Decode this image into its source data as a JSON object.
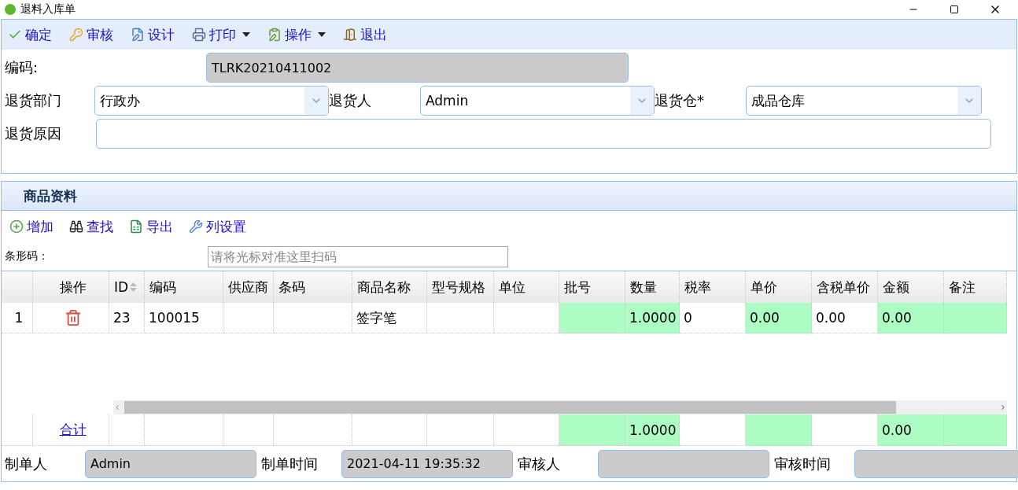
{
  "window": {
    "title": "退料入库单"
  },
  "toolbar": [
    {
      "label": "确定",
      "kind": "check",
      "menu": false
    },
    {
      "label": "审核",
      "kind": "key",
      "menu": false
    },
    {
      "label": "设计",
      "kind": "design",
      "menu": false
    },
    {
      "label": "打印",
      "kind": "print",
      "menu": true
    },
    {
      "label": "操作",
      "kind": "operate",
      "menu": true
    },
    {
      "label": "退出",
      "kind": "exit",
      "menu": false
    }
  ],
  "form": {
    "code": {
      "label": "编码:",
      "value": "TLRK20210411002"
    },
    "selects": [
      {
        "label": "退货部门",
        "value": "行政办"
      },
      {
        "label": "退货人",
        "value": "Admin"
      },
      {
        "label": "退货仓*",
        "value": "成品仓库"
      }
    ],
    "reason": {
      "label": "退货原因"
    }
  },
  "section": {
    "title": "商品资料"
  },
  "grid_toolbar": [
    {
      "label": "增加",
      "kind": "add"
    },
    {
      "label": "查找",
      "kind": "find"
    },
    {
      "label": "导出",
      "kind": "export"
    },
    {
      "label": "列设置",
      "kind": "columns"
    }
  ],
  "barcode": {
    "label": "条形码：",
    "placeholder": "请将光标对准这里扫码"
  },
  "table": {
    "columns": [
      {
        "label": "操作",
        "editable": false,
        "sortable": false
      },
      {
        "label": "ID",
        "editable": false,
        "sortable": true
      },
      {
        "label": "编码",
        "editable": false,
        "sortable": false
      },
      {
        "label": "供应商",
        "editable": false,
        "sortable": false
      },
      {
        "label": "条码",
        "editable": false,
        "sortable": false
      },
      {
        "label": "商品名称",
        "editable": false,
        "sortable": false
      },
      {
        "label": "型号规格",
        "editable": false,
        "sortable": false
      },
      {
        "label": "单位",
        "editable": false,
        "sortable": false
      },
      {
        "label": "批号",
        "editable": true,
        "sortable": false
      },
      {
        "label": "数量",
        "editable": true,
        "sortable": false
      },
      {
        "label": "税率",
        "editable": false,
        "sortable": false
      },
      {
        "label": "单价",
        "editable": true,
        "sortable": false
      },
      {
        "label": "含税单价",
        "editable": false,
        "sortable": false
      },
      {
        "label": "金额",
        "editable": true,
        "sortable": false
      },
      {
        "label": "备注",
        "editable": true,
        "sortable": false
      }
    ],
    "rows": [
      {
        "number": "1",
        "cells": [
          "",
          "23",
          "100015",
          "",
          "",
          "签字笔",
          "",
          "",
          "",
          "1.0000",
          "0",
          "0.00",
          "0.00",
          "0.00",
          ""
        ]
      }
    ],
    "footer": {
      "label": "合计",
      "cells": [
        "",
        "",
        "",
        "",
        "",
        "",
        "",
        "",
        "",
        "1.0000",
        "",
        "",
        "",
        "0.00",
        ""
      ]
    }
  },
  "bottom": [
    {
      "label": "制单人",
      "value": "Admin"
    },
    {
      "label": "制单时间",
      "value": "2021-04-11 19:35:32"
    },
    {
      "label": "审核人"
    },
    {
      "label": "审核时间"
    }
  ]
}
